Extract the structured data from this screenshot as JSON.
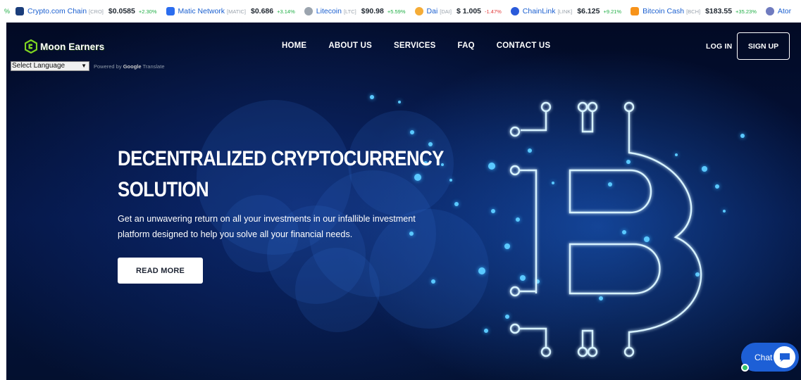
{
  "ticker": {
    "lead_fragment": "%",
    "items": [
      {
        "name": "Crypto.com Chain",
        "symbol": "[CRO]",
        "price": "$0.0585",
        "change": "+2.30%",
        "direction": "up",
        "icon": "cro-icon",
        "color": "#1a3d7a"
      },
      {
        "name": "Matic Network",
        "symbol": "[MATIC]",
        "price": "$0.686",
        "change": "+3.14%",
        "direction": "up",
        "icon": "matic-icon",
        "color": "#2b6def"
      },
      {
        "name": "Litecoin",
        "symbol": "[LTC]",
        "price": "$90.98",
        "change": "+5.59%",
        "direction": "up",
        "icon": "litecoin-icon",
        "color": "#9ba4ae"
      },
      {
        "name": "Dai",
        "symbol": "[DAI]",
        "price": "$ 1.005",
        "change": "-1.47%",
        "direction": "down",
        "icon": "dai-icon",
        "color": "#f5ac37"
      },
      {
        "name": "ChainLink",
        "symbol": "[LINK]",
        "price": "$6.125",
        "change": "+9.21%",
        "direction": "up",
        "icon": "chainlink-icon",
        "color": "#2a5ada"
      },
      {
        "name": "Bitcoin Cash",
        "symbol": "[BCH]",
        "price": "$183.55",
        "change": "+35.23%",
        "direction": "up",
        "icon": "bitcoin-cash-icon",
        "color": "#f7931a"
      },
      {
        "name": "Ator",
        "symbol": "",
        "price": "",
        "change": "",
        "direction": "up",
        "icon": "atom-icon",
        "color": "#6f7bbf"
      }
    ]
  },
  "header": {
    "logo_text": "Moon Earners",
    "language_select": "Select Language",
    "powered_by": "Powered by",
    "google": "Google",
    "translate": "Translate",
    "nav": [
      "HOME",
      "ABOUT US",
      "SERVICES",
      "FAQ",
      "CONTACT US"
    ],
    "login": "LOG IN",
    "signup": "SIGN UP"
  },
  "hero": {
    "headline_line1": "DECENTRALIZED CRYPTOCURRENCY",
    "headline_line2": "SOLUTION",
    "subtitle_line1": "Get an unwavering return on all your investments in our infallible investment",
    "subtitle_line2": "platform designed to help you solve all your financial needs.",
    "cta": "READ MORE"
  },
  "chat": {
    "label": "Chat"
  },
  "colors": {
    "accent": "#1d5fd6",
    "hero_bg": "#041441",
    "logo_green": "#7ed321",
    "positive": "#1fae45",
    "negative": "#e23b3b"
  }
}
